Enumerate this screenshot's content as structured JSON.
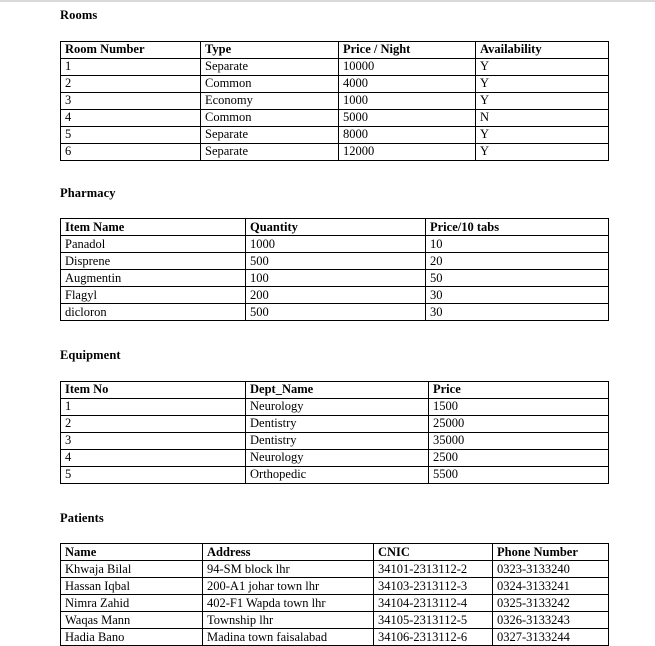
{
  "document": {
    "sections": [
      {
        "id": "rooms",
        "title": "Rooms",
        "columns": [
          "Room Number",
          "Type",
          "Price / Night",
          "Availability"
        ],
        "rows": [
          [
            "1",
            "Separate",
            "10000",
            "Y"
          ],
          [
            "2",
            "Common",
            "4000",
            "Y"
          ],
          [
            "3",
            "Economy",
            "1000",
            "Y"
          ],
          [
            "4",
            "Common",
            "5000",
            "N"
          ],
          [
            "5",
            "Separate",
            "8000",
            "Y"
          ],
          [
            "6",
            "Separate",
            "12000",
            "Y"
          ]
        ]
      },
      {
        "id": "pharmacy",
        "title": "Pharmacy",
        "columns": [
          "Item Name",
          "Quantity",
          "Price/10 tabs"
        ],
        "rows": [
          [
            "Panadol",
            "1000",
            "10"
          ],
          [
            "Disprene",
            "500",
            "20"
          ],
          [
            "Augmentin",
            "100",
            "50"
          ],
          [
            "Flagyl",
            "200",
            "30"
          ],
          [
            "dicloron",
            "500",
            "30"
          ]
        ]
      },
      {
        "id": "equipment",
        "title": "Equipment",
        "columns": [
          "Item No",
          "Dept_Name",
          "Price"
        ],
        "rows": [
          [
            "1",
            "Neurology",
            "1500"
          ],
          [
            "2",
            "Dentistry",
            "25000"
          ],
          [
            "3",
            "Dentistry",
            "35000"
          ],
          [
            "4",
            "Neurology",
            "2500"
          ],
          [
            "5",
            "Orthopedic",
            "5500"
          ]
        ]
      },
      {
        "id": "patients",
        "title": "Patients",
        "columns": [
          "Name",
          "Address",
          "CNIC",
          "Phone Number"
        ],
        "rows": [
          [
            "Khwaja Bilal",
            "94-SM block lhr",
            "34101-2313112-2",
            "0323-3133240"
          ],
          [
            "Hassan Iqbal",
            "200-A1 johar town lhr",
            "34103-2313112-3",
            "0324-3133241"
          ],
          [
            "Nimra Zahid",
            "402-F1 Wapda town lhr",
            "34104-2313112-4",
            "0325-3133242"
          ],
          [
            "Waqas Mann",
            "Township lhr",
            "34105-2313112-5",
            "0326-3133243"
          ],
          [
            "Hadia Bano",
            "Madina town faisalabad",
            "34106-2313112-6",
            "0327-3133244"
          ]
        ]
      }
    ]
  },
  "colors": {
    "border": "#000000",
    "text": "#000000",
    "background": "#ffffff",
    "top_rule": "#d9d9d9"
  }
}
